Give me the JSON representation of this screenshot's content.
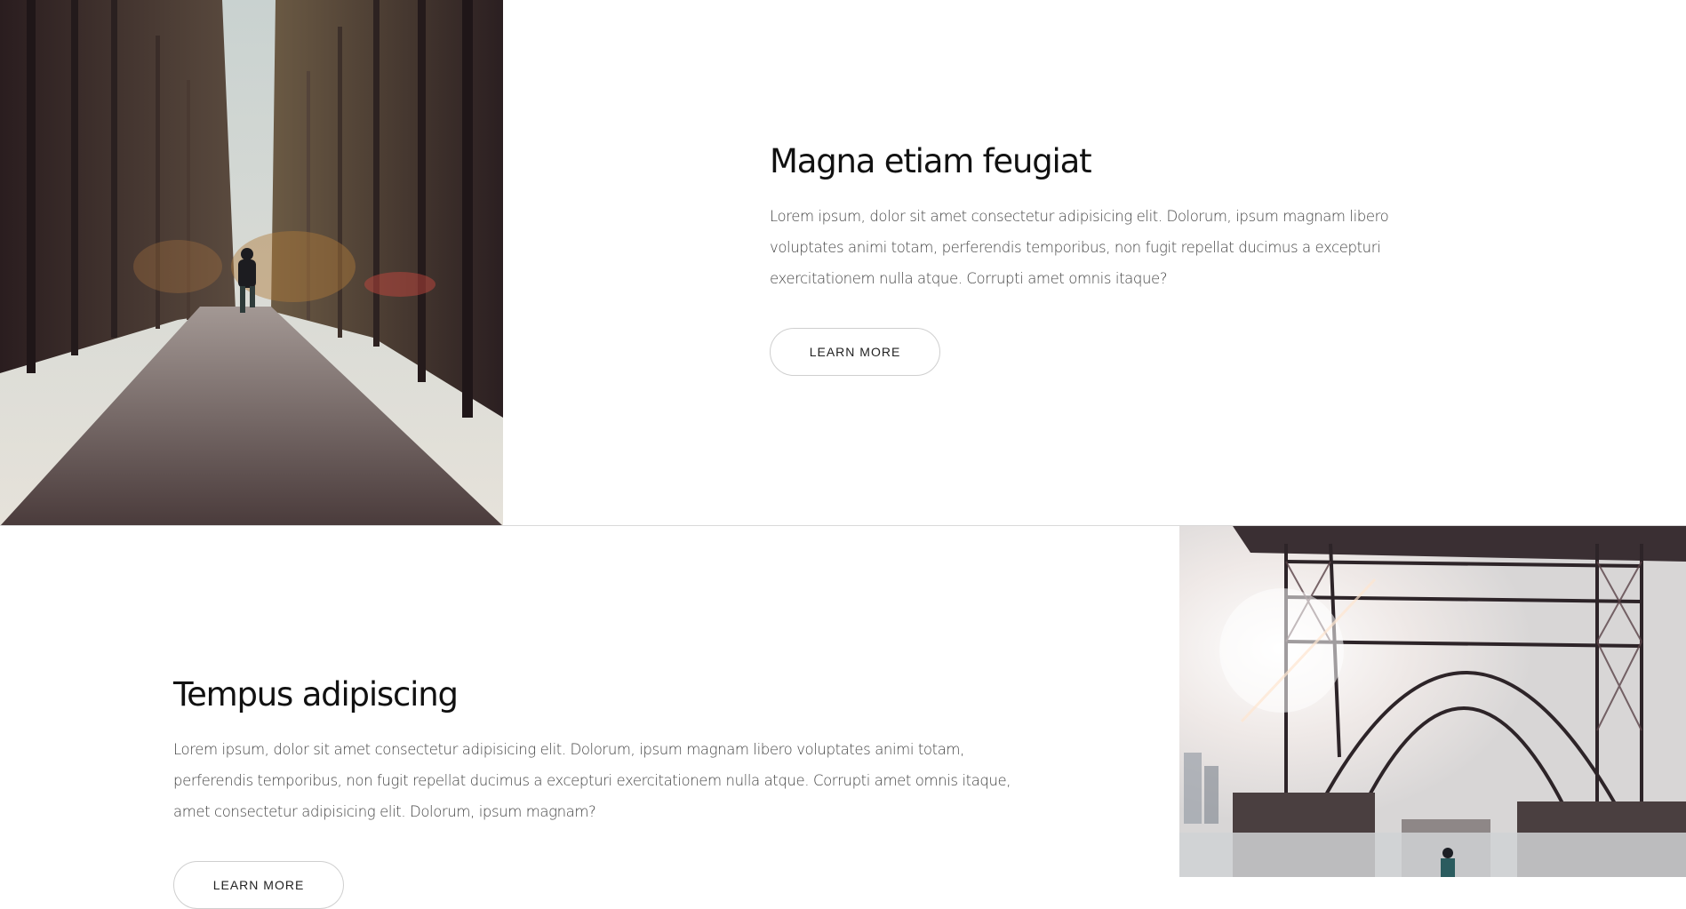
{
  "features": [
    {
      "title": "Magna etiam feugiat",
      "body_lines": [
        "Lorem ipsum, dolor sit amet consectetur adipisicing elit. Dolorum, ipsum magnam libero",
        "voluptates animi totam, perferendis temporibus, non fugit repellat ducimus a excepturi",
        "exercitationem nulla atque. Corrupti amet omnis itaque?"
      ],
      "button_label": "LEARN MORE",
      "image": "forest-trail-runner-photo"
    },
    {
      "title": "Tempus adipiscing",
      "body_lines": [
        "Lorem ipsum, dolor sit amet consectetur adipisicing elit. Dolorum, ipsum magnam libero voluptates animi totam,",
        "perferendis temporibus, non fugit repellat ducimus a excepturi exercitationem nulla atque. Corrupti amet omnis itaque,",
        "amet consectetur adipisicing elit. Dolorum, ipsum magnam?"
      ],
      "button_label": "LEARN MORE",
      "image": "bridge-underside-photo"
    }
  ],
  "colors": {
    "background": "#ffffff",
    "title": "#111111",
    "body": "#444444",
    "button_border": "#cfcfcf",
    "divider": "#d9d9d9"
  }
}
